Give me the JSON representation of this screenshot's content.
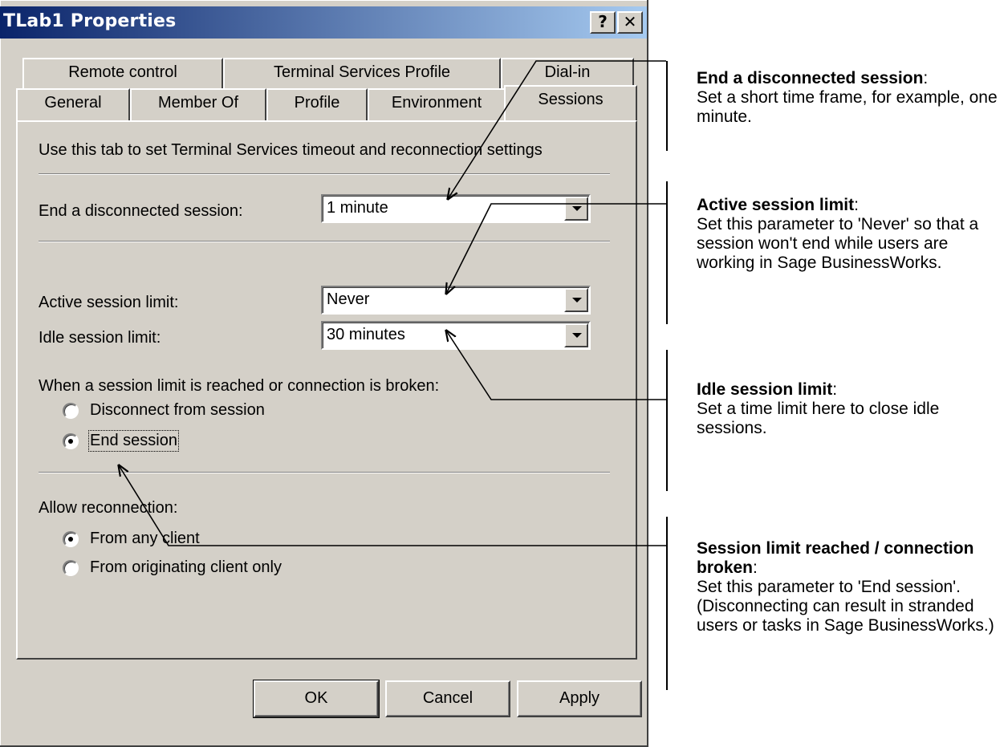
{
  "window": {
    "title": "TLab1 Properties",
    "help_glyph": "?",
    "close_glyph": "✕"
  },
  "tabs": {
    "row_back": [
      "Remote control",
      "Terminal Services Profile",
      "Dial-in"
    ],
    "row_front": [
      "General",
      "Member Of",
      "Profile",
      "Environment",
      "Sessions"
    ],
    "active": "Sessions"
  },
  "sessions": {
    "description": "Use this tab to set Terminal Services timeout and reconnection settings",
    "end_disconnected": {
      "label": "End a disconnected session:",
      "value": "1 minute"
    },
    "active_limit": {
      "label": "Active session limit:",
      "value": "Never"
    },
    "idle_limit": {
      "label": "Idle session limit:",
      "value": "30 minutes"
    },
    "limit_reached": {
      "label": "When a session limit is reached or connection is broken:",
      "options": [
        "Disconnect from session",
        "End session"
      ],
      "selected": "End session"
    },
    "reconnection": {
      "label": "Allow reconnection:",
      "options": [
        "From any client",
        "From originating client only"
      ],
      "selected": "From any client"
    }
  },
  "buttons": {
    "ok": "OK",
    "cancel": "Cancel",
    "apply": "Apply"
  },
  "annotations": [
    {
      "title": "End a disconnected session",
      "suffix": ":",
      "body": "Set a short time frame, for example, one minute."
    },
    {
      "title": "Active session limit",
      "suffix": ":",
      "body": "Set this parameter to 'Never' so that a session won't end while users are working in Sage BusinessWorks."
    },
    {
      "title": "Idle session limit",
      "suffix": ":",
      "body": "Set a time limit here to close idle sessions."
    },
    {
      "title": "Session limit reached / connection broken",
      "suffix": ":",
      "body": "Set this parameter to 'End session'. (Disconnecting can result in stranded users or tasks in Sage BusinessWorks.)"
    }
  ],
  "colors": {
    "titlebar_start": "#0a246a",
    "titlebar_end": "#a6caf0",
    "dialog_face": "#d4d0c8"
  }
}
